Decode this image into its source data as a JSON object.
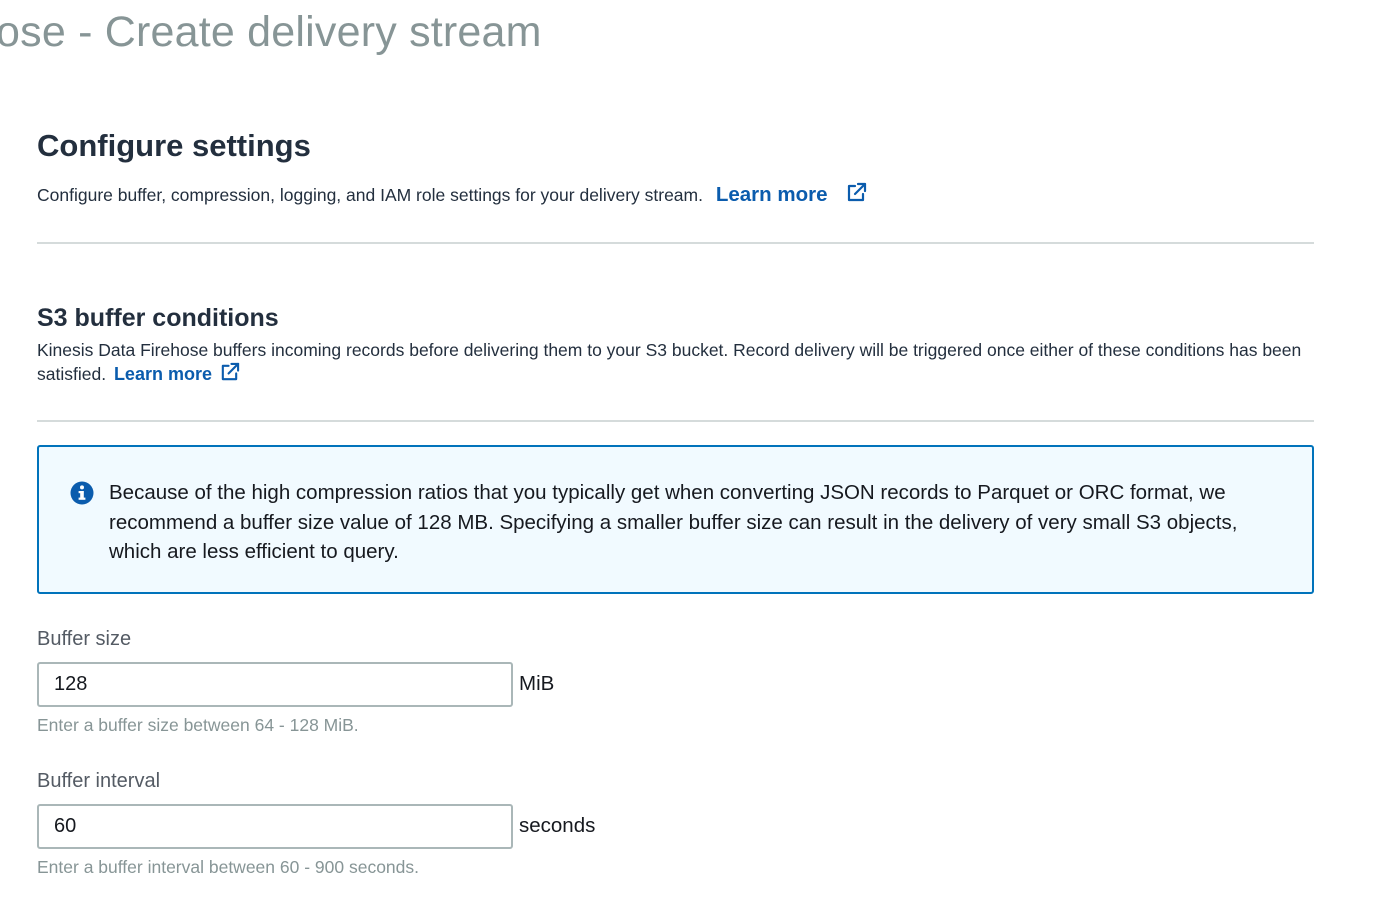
{
  "header": {
    "title": "ose - Create delivery stream"
  },
  "configure_settings": {
    "title": "Configure settings",
    "description": "Configure buffer, compression, logging, and IAM role settings for your delivery stream.",
    "learn_more": "Learn more"
  },
  "s3_buffer": {
    "title": "S3 buffer conditions",
    "description": "Kinesis Data Firehose buffers incoming records before delivering them to your S3 bucket. Record delivery will be triggered once either of these conditions has been satisfied.",
    "learn_more": "Learn more"
  },
  "info_alert": {
    "icon": "info-icon",
    "text": "Because of the high compression ratios that you typically get when converting JSON records to Parquet or ORC format, we recommend a buffer size value of 128 MB. Specifying a smaller buffer size can result in the delivery of very small S3 objects, which are less efficient to query."
  },
  "buffer_size": {
    "label": "Buffer size",
    "value": "128",
    "unit": "MiB",
    "hint": "Enter a buffer size between 64 - 128 MiB."
  },
  "buffer_interval": {
    "label": "Buffer interval",
    "value": "60",
    "unit": "seconds",
    "hint": "Enter a buffer interval between 60 - 900 seconds."
  },
  "colors": {
    "link": "#0b5cad",
    "alert_border": "#0073bb",
    "alert_background": "#f1faff",
    "title_gray": "#879596"
  }
}
